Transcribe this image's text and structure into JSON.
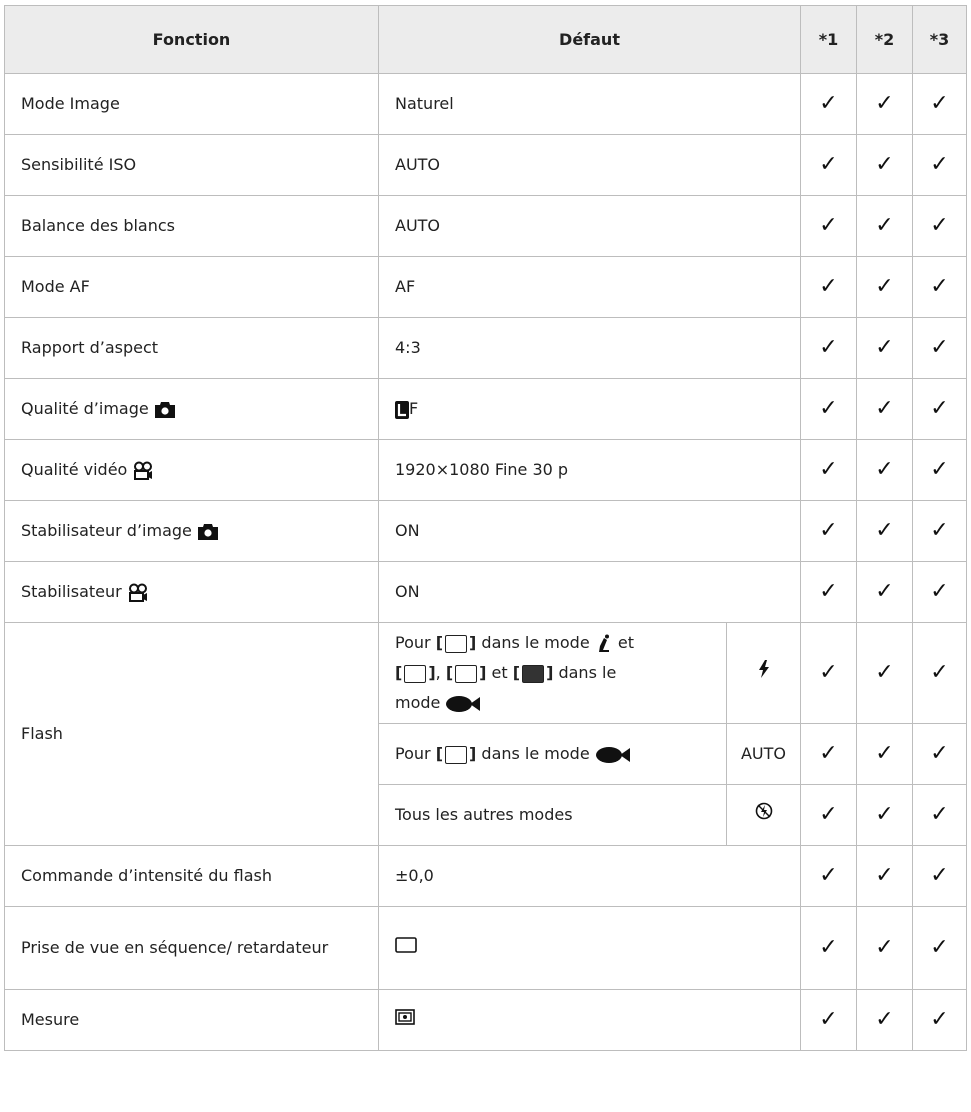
{
  "headers": {
    "function": "Fonction",
    "default": "Défaut",
    "c1": "*1",
    "c2": "*2",
    "c3": "*3"
  },
  "check": "✓",
  "rows": [
    {
      "function": "Mode Image",
      "default": "Naturel"
    },
    {
      "function": "Sensibilité ISO",
      "default": "AUTO"
    },
    {
      "function": "Balance des blancs",
      "default": "AUTO"
    },
    {
      "function": "Mode AF",
      "default": "AF"
    },
    {
      "function": "Rapport d’aspect",
      "default": "4:3"
    },
    {
      "function": "Qualité d’image",
      "default": "F"
    },
    {
      "function": "Qualité vidéo",
      "default": "1920×1080 Fine 30 p"
    },
    {
      "function": "Stabilisateur d’image",
      "default": "ON"
    },
    {
      "function": "Stabilisateur",
      "default": "ON"
    }
  ],
  "flash": {
    "label": "Flash",
    "sub1": {
      "t1": "Pour",
      "t2": "dans le mode",
      "t3": "et",
      "t4": ",",
      "t5": "et",
      "t6": "dans le",
      "t7": "mode"
    },
    "sub2": {
      "t1": "Pour",
      "t2": "dans le mode",
      "value": "AUTO"
    },
    "sub3": {
      "text": "Tous les autres modes"
    }
  },
  "rows2": [
    {
      "function": "Commande d’intensité du flash",
      "default": "±0,0"
    },
    {
      "function": "Prise de vue en séquence/ retardateur"
    },
    {
      "function": "Mesure"
    }
  ]
}
